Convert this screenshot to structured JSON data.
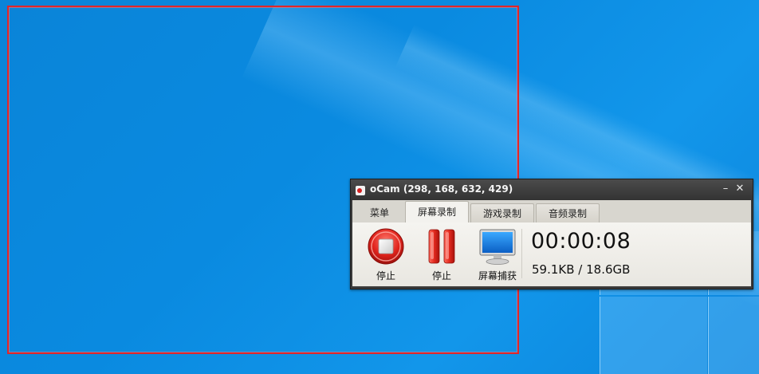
{
  "window": {
    "title": "oCam (298, 168, 632, 429)",
    "minimize_label": "–",
    "close_label": "✕"
  },
  "tabs": [
    {
      "label": "菜单"
    },
    {
      "label": "屏幕录制",
      "active": true
    },
    {
      "label": "游戏录制"
    },
    {
      "label": "音频录制"
    }
  ],
  "toolbar": {
    "stop_record_label": "停止",
    "pause_label": "停止",
    "screenshot_label": "屏幕捕获"
  },
  "status": {
    "timer": "00:00:08",
    "size": "59.1KB / 18.6GB"
  },
  "colors": {
    "capture_rect": "#e0262a",
    "desktop": "#0a8ae0"
  },
  "icons": {
    "stop": "stop-record-icon",
    "pause": "pause-icon",
    "screenshot": "monitor-icon"
  }
}
